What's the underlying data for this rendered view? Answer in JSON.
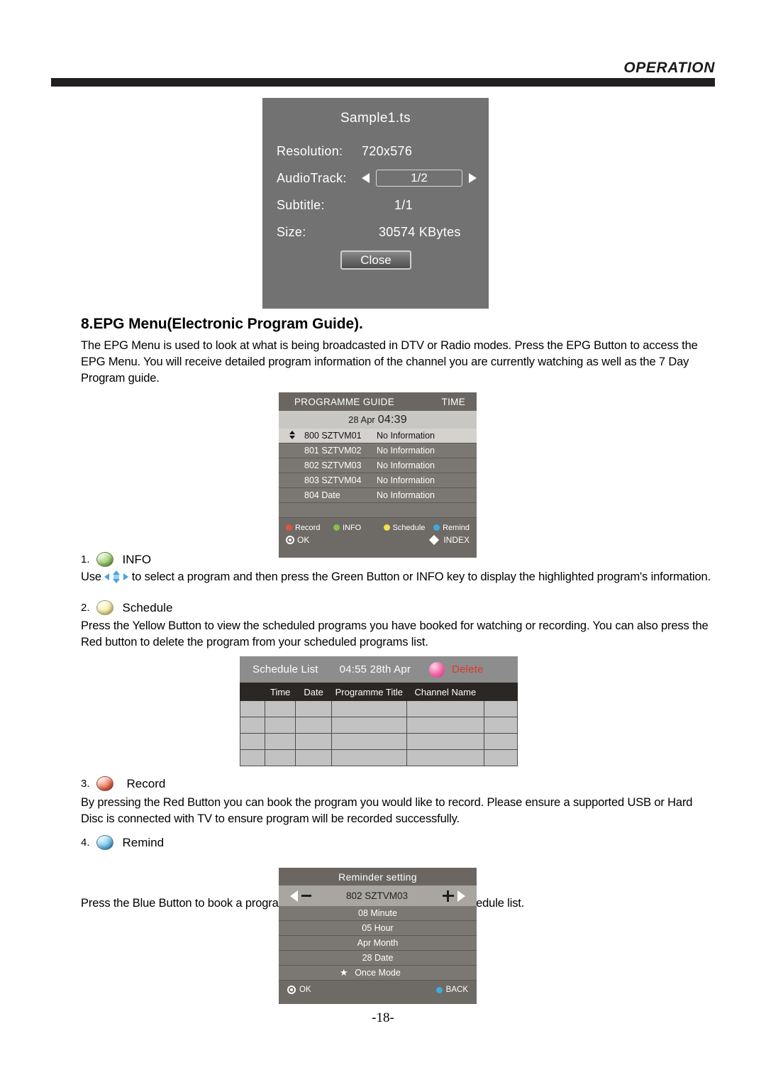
{
  "header": {
    "title": "OPERATION"
  },
  "media_info": {
    "filename": "Sample1.ts",
    "rows": [
      {
        "label": "Resolution:",
        "value": "720x576"
      },
      {
        "label": "AudioTrack:",
        "value": "1/2"
      },
      {
        "label": "Subtitle:",
        "value": "1/1"
      },
      {
        "label": "Size:",
        "value": "30574 KBytes"
      }
    ],
    "close_label": "Close"
  },
  "section": {
    "title": "8.EPG Menu(Electronic Program Guide).",
    "intro": "The EPG Menu is used to look at what is being broadcasted in DTV or Radio modes. Press the EPG Button to access the EPG Menu. You will receive detailed program information of the channel you are currently watching as well as the 7 Day Program guide."
  },
  "items": [
    {
      "num": "1.",
      "color": "green",
      "label": "INFO",
      "body_before": "Use",
      "body_after": "to select a program and then press the Green Button or INFO key to display the highlighted program's information."
    },
    {
      "num": "2.",
      "color": "yellow",
      "label": "Schedule",
      "body": "Press the Yellow Button to view the scheduled programs you have booked for watching or recording. You can also press the Red button to delete the program from your scheduled programs list."
    },
    {
      "num": "3.",
      "color": "red",
      "label": "Record",
      "body": "By pressing the Red Button you can book the program you would like to record. Please ensure a supported USB or Hard Disc is connected with TV to ensure program will be recorded successfully."
    },
    {
      "num": "4.",
      "color": "blue",
      "label": "Remind",
      "body": "Press the Blue Button to book a program for future viewing and add to the schedule list."
    }
  ],
  "epg": {
    "title": "PROGRAMME GUIDE",
    "time_label": "TIME",
    "date_day": "28 Apr",
    "date_time": "04:39",
    "rows": [
      {
        "channel": "800 SZTVM01",
        "info": "No Information",
        "selected": true
      },
      {
        "channel": "801 SZTVM02",
        "info": "No Information",
        "selected": false
      },
      {
        "channel": "802 SZTVM03",
        "info": "No Information",
        "selected": false
      },
      {
        "channel": "803 SZTVM04",
        "info": "No Information",
        "selected": false
      },
      {
        "channel": "804 Date",
        "info": "No Information",
        "selected": false
      }
    ],
    "footer": {
      "record": "Record",
      "info": "INFO",
      "schedule": "Schedule",
      "remind": "Remind",
      "ok": "OK",
      "index": "INDEX"
    },
    "colors": {
      "record": "#e2533c",
      "info": "#86c24a",
      "schedule": "#efe14d",
      "remind": "#3fa9e0"
    }
  },
  "schedule": {
    "title": "Schedule List",
    "time": "04:55 28th Apr",
    "delete_label": "Delete",
    "delete_color": "#e2392c",
    "columns": [
      "",
      "Time",
      "Date",
      "Programme Title",
      "Channel Name",
      ""
    ],
    "rows": [
      [
        "",
        "",
        "",
        "",
        "",
        ""
      ],
      [
        "",
        "",
        "",
        "",
        "",
        ""
      ],
      [
        "",
        "",
        "",
        "",
        "",
        ""
      ],
      [
        "",
        "",
        "",
        "",
        "",
        ""
      ]
    ]
  },
  "reminder": {
    "title": "Reminder setting",
    "channel": "802 SZTVM03",
    "rows": [
      {
        "text": "08 Minute",
        "star": false
      },
      {
        "text": "05 Hour",
        "star": false
      },
      {
        "text": "Apr Month",
        "star": false
      },
      {
        "text": "28 Date",
        "star": false
      },
      {
        "text": "Once Mode",
        "star": true
      }
    ],
    "footer": {
      "ok": "OK",
      "back": "BACK"
    }
  },
  "page_number": "-18-"
}
